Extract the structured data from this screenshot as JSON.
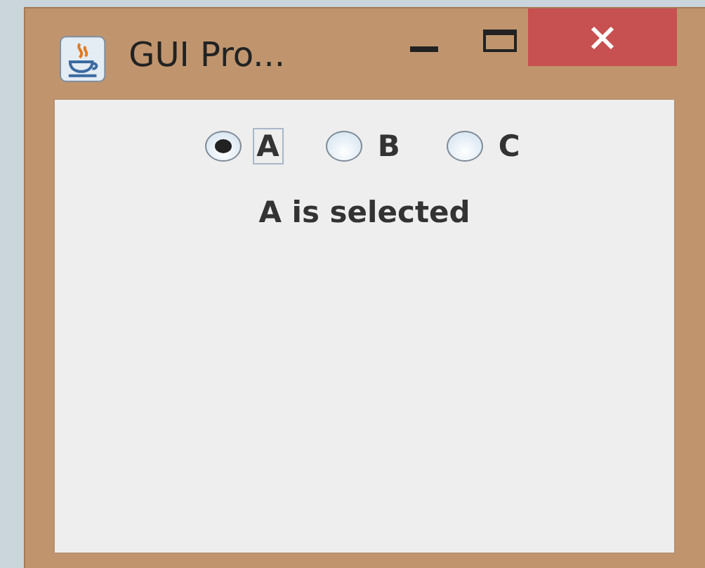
{
  "window": {
    "title": "GUI Pro..."
  },
  "options": [
    {
      "label": "A",
      "selected": true,
      "focused": true
    },
    {
      "label": "B",
      "selected": false,
      "focused": false
    },
    {
      "label": "C",
      "selected": false,
      "focused": false
    }
  ],
  "status": "A is selected"
}
